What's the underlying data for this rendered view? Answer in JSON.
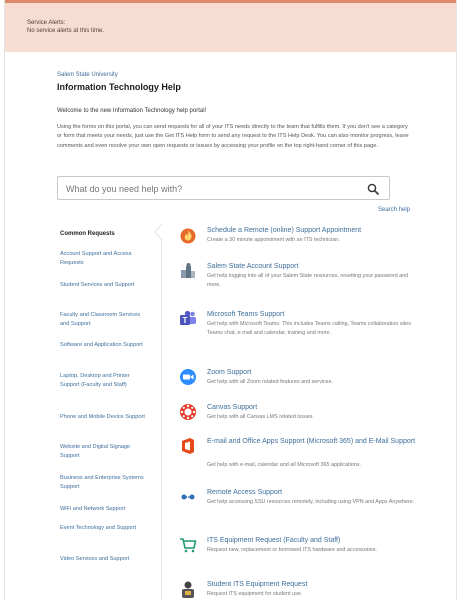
{
  "alert": {
    "title": "Service Alerts:",
    "text": "No service alerts at this time."
  },
  "header": {
    "breadcrumb": "Salem State University",
    "title": "Information Technology Help",
    "welcome": "Welcome to the new Information Technology help portal!",
    "description": "Using the forms on this portal, you can send requests for all of your ITS needs directly to the team that fulfills them. If you don't see a category or form that meets your needs, just use the Get ITS Help form to send any request to the ITS Help Desk. You can also monitor progress, leave comments and even resolve your own open requests or issues by accessing your profile on the top right-hand corner of this page."
  },
  "search": {
    "placeholder": "What do you need help with?",
    "help_link": "Search help"
  },
  "sidebar": {
    "title": "Common Requests",
    "items": [
      {
        "label": "Account Support and Access Requests"
      },
      {
        "label": "Student Services and Support"
      },
      {
        "label": "Faculty and Classroom Services and Support"
      },
      {
        "label": "Software and Application Support"
      },
      {
        "label": "Laptop, Desktop and Printer Support (Faculty and Staff)"
      },
      {
        "label": "Phone and Mobile Device Support"
      },
      {
        "label": "Website and Digital Signage Support"
      },
      {
        "label": "Business and Enterprise Systems Support"
      },
      {
        "label": "WiFi and Network Support"
      },
      {
        "label": "Event Technology and Support"
      },
      {
        "label": "Video Services and Support"
      }
    ]
  },
  "requests": [
    {
      "title": "Schedule a Remote (online) Support Appointment",
      "desc": "Create a 30 minute appointment with an ITS technician.",
      "icon": "calendar-flame-icon"
    },
    {
      "title": "Salem State Account Support",
      "desc": "Get help logging into all of your Salem State resources, resetting your password and more.",
      "icon": "accounts-icon"
    },
    {
      "title": "Microsoft Teams Support",
      "desc": "Get help with Microsoft Teams. This includes Teams calling, Teams collaboration sites Teams chat, e-mail and calendar, training and more.",
      "icon": "teams-icon"
    },
    {
      "title": "Zoom Support",
      "desc": "Get help with all Zoom related features and services.",
      "icon": "zoom-icon"
    },
    {
      "title": "Canvas Support",
      "desc": "Get help with all Canvas LMS related issues.",
      "icon": "canvas-icon"
    },
    {
      "title": "E-mail and Office Apps Support (Microsoft 365) and E-Mail Support",
      "desc": "Get help with e-mail, calendar and all Microsoft 365 applications.",
      "icon": "office-icon"
    },
    {
      "title": "Remote Access Support",
      "desc": "Get help accessing SSU resources remotely, including using VPN and Apps Anywhere.",
      "icon": "remote-access-icon"
    },
    {
      "title": "ITS Equipment Request (Faculty and Staff)",
      "desc": "Request new, replacement or borrowed ITS hardware and accessories.",
      "icon": "cart-icon"
    },
    {
      "title": "Student ITS Equipment Request",
      "desc": "Request ITS equipment for student use.",
      "icon": "student-icon"
    }
  ],
  "colors": {
    "alert_bg": "#f7dcd2",
    "alert_border": "#e08a6c",
    "link": "#3d6e9b"
  }
}
